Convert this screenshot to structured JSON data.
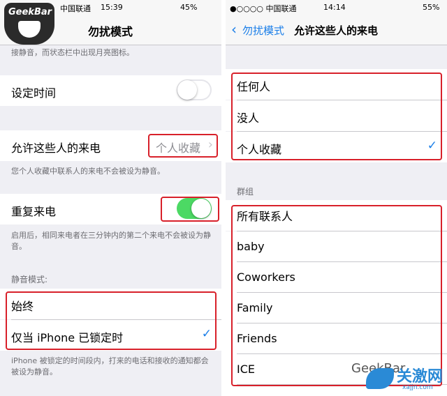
{
  "left": {
    "status": {
      "carrier": "中国联通",
      "time": "15:39",
      "battery": "45%"
    },
    "nav": {
      "title": "勿扰模式"
    },
    "intro_text": "接静音，而状态栏中出现月亮图标。",
    "scheduled": {
      "label": "设定时间",
      "on": false
    },
    "allow_calls": {
      "label": "允许这些人的来电",
      "value": "个人收藏",
      "footer": "您个人收藏中联系人的来电不会被设为静音。"
    },
    "repeated_calls": {
      "label": "重复来电",
      "on": true,
      "footer": "启用后，相同来电者在三分钟内的第二个来电不会被设为静音。"
    },
    "silence": {
      "header": "静音模式:",
      "options": [
        "始终",
        "仅当 iPhone 已锁定时"
      ],
      "selected_index": 1,
      "footer": "iPhone 被锁定的时间段内，打来的电话和接收的通知都会被设为静音。"
    },
    "logo_text": "GeekBar"
  },
  "right": {
    "status": {
      "carrier": "●○○○○ 中国联通",
      "time": "14:14",
      "battery": "55%"
    },
    "nav": {
      "back": "勿扰模式",
      "title": "允许这些人的来电"
    },
    "options": [
      "任何人",
      "没人",
      "个人收藏"
    ],
    "selected_index": 2,
    "groups_header": "群组",
    "groups": [
      "所有联系人",
      "baby",
      "Coworkers",
      "Family",
      "Friends",
      "ICE"
    ],
    "watermark_gray": "GeekBar",
    "watermark": {
      "text": "关激网",
      "sub": "xajjn.com"
    }
  },
  "colors": {
    "accent": "#1a7ee8",
    "switch_on": "#4cd964",
    "highlight": "#d8202a",
    "background": "#efeff4"
  }
}
